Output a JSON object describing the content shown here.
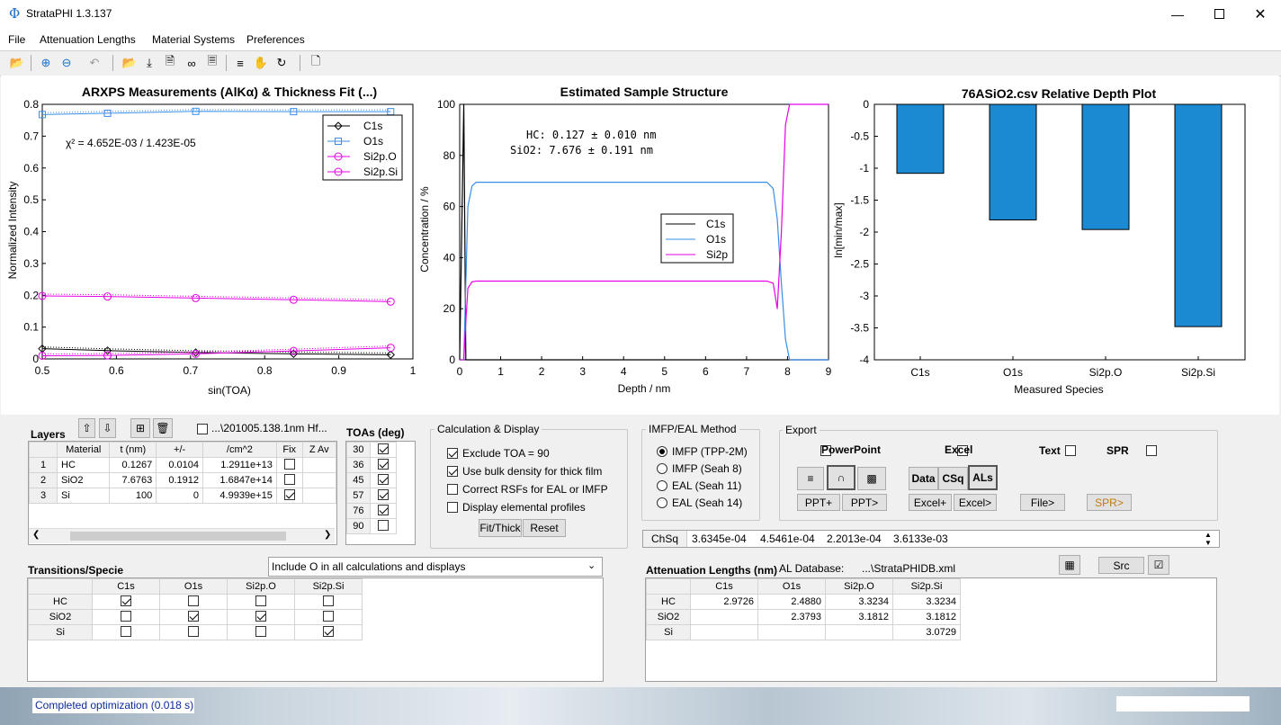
{
  "window": {
    "title": "StrataPHI 1.3.137",
    "logo": "Φ"
  },
  "menu": [
    "File",
    "Attenuation Lengths",
    "Material Systems",
    "Preferences"
  ],
  "plot1": {
    "title": "ARXPS Measurements (AlKα) & Thickness Fit (...)",
    "xlabel": "sin(TOA)",
    "ylabel": "Normalized Intensity",
    "chi": "χ² = 4.652E-03 / 1.423E-05",
    "xticks": [
      "0.5",
      "0.6",
      "0.7",
      "0.8",
      "0.9",
      "1"
    ],
    "yticks": [
      "0",
      "0.1",
      "0.2",
      "0.3",
      "0.4",
      "0.5",
      "0.6",
      "0.7",
      "0.8"
    ],
    "legend": [
      "C1s",
      "O1s",
      "Si2p.O",
      "Si2p.Si"
    ]
  },
  "plot2": {
    "title": "Estimated Sample Structure",
    "xlabel": "Depth / nm",
    "ylabel": "Concentration / %",
    "line1": "HC: 0.127 ± 0.010 nm",
    "line2": "SiO2: 7.676 ± 0.191 nm",
    "xticks": [
      "0",
      "1",
      "2",
      "3",
      "4",
      "5",
      "6",
      "7",
      "8",
      "9"
    ],
    "yticks": [
      "0",
      "20",
      "40",
      "60",
      "80",
      "100"
    ],
    "legend": [
      "C1s",
      "O1s",
      "Si2p"
    ]
  },
  "plot3": {
    "title": "76ASiO2.csv Relative Depth Plot",
    "xlabel": "Measured Species",
    "ylabel": "ln[min/max]",
    "yticks": [
      "0",
      "-0.5",
      "-1",
      "-1.5",
      "-2",
      "-2.5",
      "-3",
      "-3.5",
      "-4"
    ]
  },
  "chart_data": [
    {
      "type": "line",
      "title": "ARXPS Measurements (AlKα) & Thickness Fit (...)",
      "xlabel": "sin(TOA)",
      "ylabel": "Normalized Intensity",
      "xlim": [
        0.5,
        1
      ],
      "ylim": [
        0,
        0.8
      ],
      "x": [
        0.5,
        0.588,
        0.707,
        0.839,
        0.97
      ],
      "series": [
        {
          "name": "C1s",
          "color": "#000000",
          "marker": "diamond",
          "values": [
            0.032,
            0.026,
            0.02,
            0.016,
            0.013
          ]
        },
        {
          "name": "O1s",
          "color": "#3a8ee6",
          "marker": "square",
          "values": [
            0.768,
            0.772,
            0.778,
            0.777,
            0.777
          ]
        },
        {
          "name": "Si2p.O",
          "color": "#e600e6",
          "marker": "circle",
          "values": [
            0.198,
            0.196,
            0.191,
            0.186,
            0.18
          ]
        },
        {
          "name": "Si2p.Si",
          "color": "#e600e6",
          "marker": "circle",
          "values": [
            0.01,
            0.011,
            0.016,
            0.025,
            0.035
          ]
        }
      ],
      "legend": "top-right"
    },
    {
      "type": "line",
      "title": "Estimated Sample Structure",
      "xlabel": "Depth / nm",
      "ylabel": "Concentration / %",
      "xlim": [
        0,
        9
      ],
      "ylim": [
        0,
        100
      ],
      "x": [
        0,
        0.1,
        0.15,
        0.2,
        0.3,
        0.4,
        7.5,
        7.65,
        7.75,
        7.85,
        7.95,
        8.05,
        8.2,
        9
      ],
      "series": [
        {
          "name": "C1s",
          "color": "#000000",
          "values": [
            0,
            100,
            0,
            0,
            0,
            0,
            0,
            0,
            0,
            0,
            0,
            0,
            0,
            0
          ]
        },
        {
          "name": "O1s",
          "color": "#3a8ee6",
          "values": [
            0,
            0,
            30,
            60,
            68,
            69.5,
            69.5,
            67,
            55,
            30,
            8,
            0,
            0,
            0
          ]
        },
        {
          "name": "Si2p",
          "color": "#e600e6",
          "values": [
            0,
            0,
            15,
            28,
            30.5,
            30.8,
            30.8,
            30,
            20,
            50,
            92,
            100,
            100,
            100
          ]
        }
      ],
      "legend": "center"
    },
    {
      "type": "bar",
      "title": "76ASiO2.csv Relative Depth Plot",
      "xlabel": "Measured Species",
      "ylabel": "ln[min/max]",
      "categories": [
        "C1s",
        "O1s",
        "Si2p.O",
        "Si2p.Si"
      ],
      "values": [
        -1.08,
        -1.81,
        -1.96,
        -3.48
      ],
      "ylim": [
        -4,
        0
      ],
      "color": "#1b8ad3"
    }
  ],
  "layers": {
    "title": "Layers",
    "file_label": "...\\201005.138.1nm Hf...",
    "columns": [
      "",
      "Material",
      "t (nm)",
      "+/-",
      "/cm^2",
      "Fix",
      "Z Av"
    ],
    "rows": [
      {
        "n": "1",
        "material": "HC",
        "t": "0.1267",
        "pm": "0.0104",
        "cm2": "1.2911e+13",
        "fix": false
      },
      {
        "n": "2",
        "material": "SiO2",
        "t": "7.6763",
        "pm": "0.1912",
        "cm2": "1.6847e+14",
        "fix": false
      },
      {
        "n": "3",
        "material": "Si",
        "t": "100",
        "pm": "0",
        "cm2": "4.9939e+15",
        "fix": true
      }
    ]
  },
  "toas": {
    "title": "TOAs (deg)",
    "rows": [
      {
        "angle": "30",
        "on": true
      },
      {
        "angle": "36",
        "on": true
      },
      {
        "angle": "45",
        "on": true
      },
      {
        "angle": "57",
        "on": true
      },
      {
        "angle": "76",
        "on": true
      },
      {
        "angle": "90",
        "on": false
      }
    ]
  },
  "calc": {
    "title": "Calculation & Display",
    "options": [
      {
        "label": "Exclude TOA = 90",
        "on": true
      },
      {
        "label": "Use bulk density for thick film",
        "on": true
      },
      {
        "label": "Correct RSFs for EAL or IMFP",
        "on": false
      },
      {
        "label": "Display elemental profiles",
        "on": false
      }
    ],
    "fit_btn": "Fit/Thick",
    "reset_btn": "Reset"
  },
  "imfp": {
    "title": "IMFP/EAL Method",
    "options": [
      {
        "label": "IMFP (TPP-2M)",
        "on": true
      },
      {
        "label": "IMFP (Seah 8)",
        "on": false
      },
      {
        "label": "EAL (Seah 11)",
        "on": false
      },
      {
        "label": "EAL (Seah 14)",
        "on": false
      }
    ]
  },
  "export": {
    "title": "Export",
    "powerpoint": "PowerPoint",
    "excel": "Excel",
    "text": "Text",
    "spr": "SPR",
    "data_btn": "Data",
    "csq_btn": "CSq",
    "als_btn": "ALs",
    "ppt_plus": "PPT+",
    "ppt_gt": "PPT>",
    "excel_plus": "Excel+",
    "excel_gt": "Excel>",
    "file_gt": "File>",
    "spr_gt": "SPR>",
    "spr_color": "#c07a10"
  },
  "chisq": {
    "label": "ChSq",
    "values": [
      "3.6345e-04",
      "4.5461e-04",
      "2.2013e-04",
      "3.6133e-03"
    ]
  },
  "transitions": {
    "title": "Transitions/Specie",
    "dropdown": "Include O in all calculations and displays",
    "columns": [
      "C1s",
      "O1s",
      "Si2p.O",
      "Si2p.Si"
    ],
    "rows": [
      {
        "name": "HC",
        "checks": [
          true,
          false,
          false,
          false
        ]
      },
      {
        "name": "SiO2",
        "checks": [
          false,
          true,
          true,
          false
        ]
      },
      {
        "name": "Si",
        "checks": [
          false,
          false,
          false,
          true
        ]
      }
    ]
  },
  "atten": {
    "title": "Attenuation Lengths (nm)",
    "db_label": "AL Database:",
    "db_value": "...\\StrataPHIDB.xml",
    "src_btn": "Src",
    "columns": [
      "C1s",
      "O1s",
      "Si2p.O",
      "Si2p.Si"
    ],
    "rows": [
      {
        "name": "HC",
        "vals": [
          "2.9726",
          "2.4880",
          "3.3234",
          "3.3234"
        ]
      },
      {
        "name": "SiO2",
        "vals": [
          "",
          "2.3793",
          "3.1812",
          "3.1812"
        ]
      },
      {
        "name": "Si",
        "vals": [
          "",
          "",
          "",
          "3.0729"
        ]
      }
    ]
  },
  "status": {
    "text": "Completed optimization (0.018 s)"
  }
}
